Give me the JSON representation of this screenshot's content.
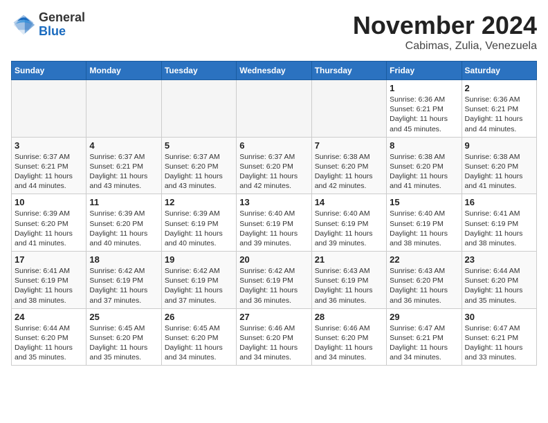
{
  "logo": {
    "general": "General",
    "blue": "Blue"
  },
  "header": {
    "month": "November 2024",
    "location": "Cabimas, Zulia, Venezuela"
  },
  "days_of_week": [
    "Sunday",
    "Monday",
    "Tuesday",
    "Wednesday",
    "Thursday",
    "Friday",
    "Saturday"
  ],
  "weeks": [
    [
      {
        "day": "",
        "empty": true
      },
      {
        "day": "",
        "empty": true
      },
      {
        "day": "",
        "empty": true
      },
      {
        "day": "",
        "empty": true
      },
      {
        "day": "",
        "empty": true
      },
      {
        "day": "1",
        "sunrise": "Sunrise: 6:36 AM",
        "sunset": "Sunset: 6:21 PM",
        "daylight": "Daylight: 11 hours and 45 minutes."
      },
      {
        "day": "2",
        "sunrise": "Sunrise: 6:36 AM",
        "sunset": "Sunset: 6:21 PM",
        "daylight": "Daylight: 11 hours and 44 minutes."
      }
    ],
    [
      {
        "day": "3",
        "sunrise": "Sunrise: 6:37 AM",
        "sunset": "Sunset: 6:21 PM",
        "daylight": "Daylight: 11 hours and 44 minutes."
      },
      {
        "day": "4",
        "sunrise": "Sunrise: 6:37 AM",
        "sunset": "Sunset: 6:21 PM",
        "daylight": "Daylight: 11 hours and 43 minutes."
      },
      {
        "day": "5",
        "sunrise": "Sunrise: 6:37 AM",
        "sunset": "Sunset: 6:20 PM",
        "daylight": "Daylight: 11 hours and 43 minutes."
      },
      {
        "day": "6",
        "sunrise": "Sunrise: 6:37 AM",
        "sunset": "Sunset: 6:20 PM",
        "daylight": "Daylight: 11 hours and 42 minutes."
      },
      {
        "day": "7",
        "sunrise": "Sunrise: 6:38 AM",
        "sunset": "Sunset: 6:20 PM",
        "daylight": "Daylight: 11 hours and 42 minutes."
      },
      {
        "day": "8",
        "sunrise": "Sunrise: 6:38 AM",
        "sunset": "Sunset: 6:20 PM",
        "daylight": "Daylight: 11 hours and 41 minutes."
      },
      {
        "day": "9",
        "sunrise": "Sunrise: 6:38 AM",
        "sunset": "Sunset: 6:20 PM",
        "daylight": "Daylight: 11 hours and 41 minutes."
      }
    ],
    [
      {
        "day": "10",
        "sunrise": "Sunrise: 6:39 AM",
        "sunset": "Sunset: 6:20 PM",
        "daylight": "Daylight: 11 hours and 41 minutes."
      },
      {
        "day": "11",
        "sunrise": "Sunrise: 6:39 AM",
        "sunset": "Sunset: 6:20 PM",
        "daylight": "Daylight: 11 hours and 40 minutes."
      },
      {
        "day": "12",
        "sunrise": "Sunrise: 6:39 AM",
        "sunset": "Sunset: 6:19 PM",
        "daylight": "Daylight: 11 hours and 40 minutes."
      },
      {
        "day": "13",
        "sunrise": "Sunrise: 6:40 AM",
        "sunset": "Sunset: 6:19 PM",
        "daylight": "Daylight: 11 hours and 39 minutes."
      },
      {
        "day": "14",
        "sunrise": "Sunrise: 6:40 AM",
        "sunset": "Sunset: 6:19 PM",
        "daylight": "Daylight: 11 hours and 39 minutes."
      },
      {
        "day": "15",
        "sunrise": "Sunrise: 6:40 AM",
        "sunset": "Sunset: 6:19 PM",
        "daylight": "Daylight: 11 hours and 38 minutes."
      },
      {
        "day": "16",
        "sunrise": "Sunrise: 6:41 AM",
        "sunset": "Sunset: 6:19 PM",
        "daylight": "Daylight: 11 hours and 38 minutes."
      }
    ],
    [
      {
        "day": "17",
        "sunrise": "Sunrise: 6:41 AM",
        "sunset": "Sunset: 6:19 PM",
        "daylight": "Daylight: 11 hours and 38 minutes."
      },
      {
        "day": "18",
        "sunrise": "Sunrise: 6:42 AM",
        "sunset": "Sunset: 6:19 PM",
        "daylight": "Daylight: 11 hours and 37 minutes."
      },
      {
        "day": "19",
        "sunrise": "Sunrise: 6:42 AM",
        "sunset": "Sunset: 6:19 PM",
        "daylight": "Daylight: 11 hours and 37 minutes."
      },
      {
        "day": "20",
        "sunrise": "Sunrise: 6:42 AM",
        "sunset": "Sunset: 6:19 PM",
        "daylight": "Daylight: 11 hours and 36 minutes."
      },
      {
        "day": "21",
        "sunrise": "Sunrise: 6:43 AM",
        "sunset": "Sunset: 6:19 PM",
        "daylight": "Daylight: 11 hours and 36 minutes."
      },
      {
        "day": "22",
        "sunrise": "Sunrise: 6:43 AM",
        "sunset": "Sunset: 6:20 PM",
        "daylight": "Daylight: 11 hours and 36 minutes."
      },
      {
        "day": "23",
        "sunrise": "Sunrise: 6:44 AM",
        "sunset": "Sunset: 6:20 PM",
        "daylight": "Daylight: 11 hours and 35 minutes."
      }
    ],
    [
      {
        "day": "24",
        "sunrise": "Sunrise: 6:44 AM",
        "sunset": "Sunset: 6:20 PM",
        "daylight": "Daylight: 11 hours and 35 minutes."
      },
      {
        "day": "25",
        "sunrise": "Sunrise: 6:45 AM",
        "sunset": "Sunset: 6:20 PM",
        "daylight": "Daylight: 11 hours and 35 minutes."
      },
      {
        "day": "26",
        "sunrise": "Sunrise: 6:45 AM",
        "sunset": "Sunset: 6:20 PM",
        "daylight": "Daylight: 11 hours and 34 minutes."
      },
      {
        "day": "27",
        "sunrise": "Sunrise: 6:46 AM",
        "sunset": "Sunset: 6:20 PM",
        "daylight": "Daylight: 11 hours and 34 minutes."
      },
      {
        "day": "28",
        "sunrise": "Sunrise: 6:46 AM",
        "sunset": "Sunset: 6:20 PM",
        "daylight": "Daylight: 11 hours and 34 minutes."
      },
      {
        "day": "29",
        "sunrise": "Sunrise: 6:47 AM",
        "sunset": "Sunset: 6:21 PM",
        "daylight": "Daylight: 11 hours and 34 minutes."
      },
      {
        "day": "30",
        "sunrise": "Sunrise: 6:47 AM",
        "sunset": "Sunset: 6:21 PM",
        "daylight": "Daylight: 11 hours and 33 minutes."
      }
    ]
  ]
}
